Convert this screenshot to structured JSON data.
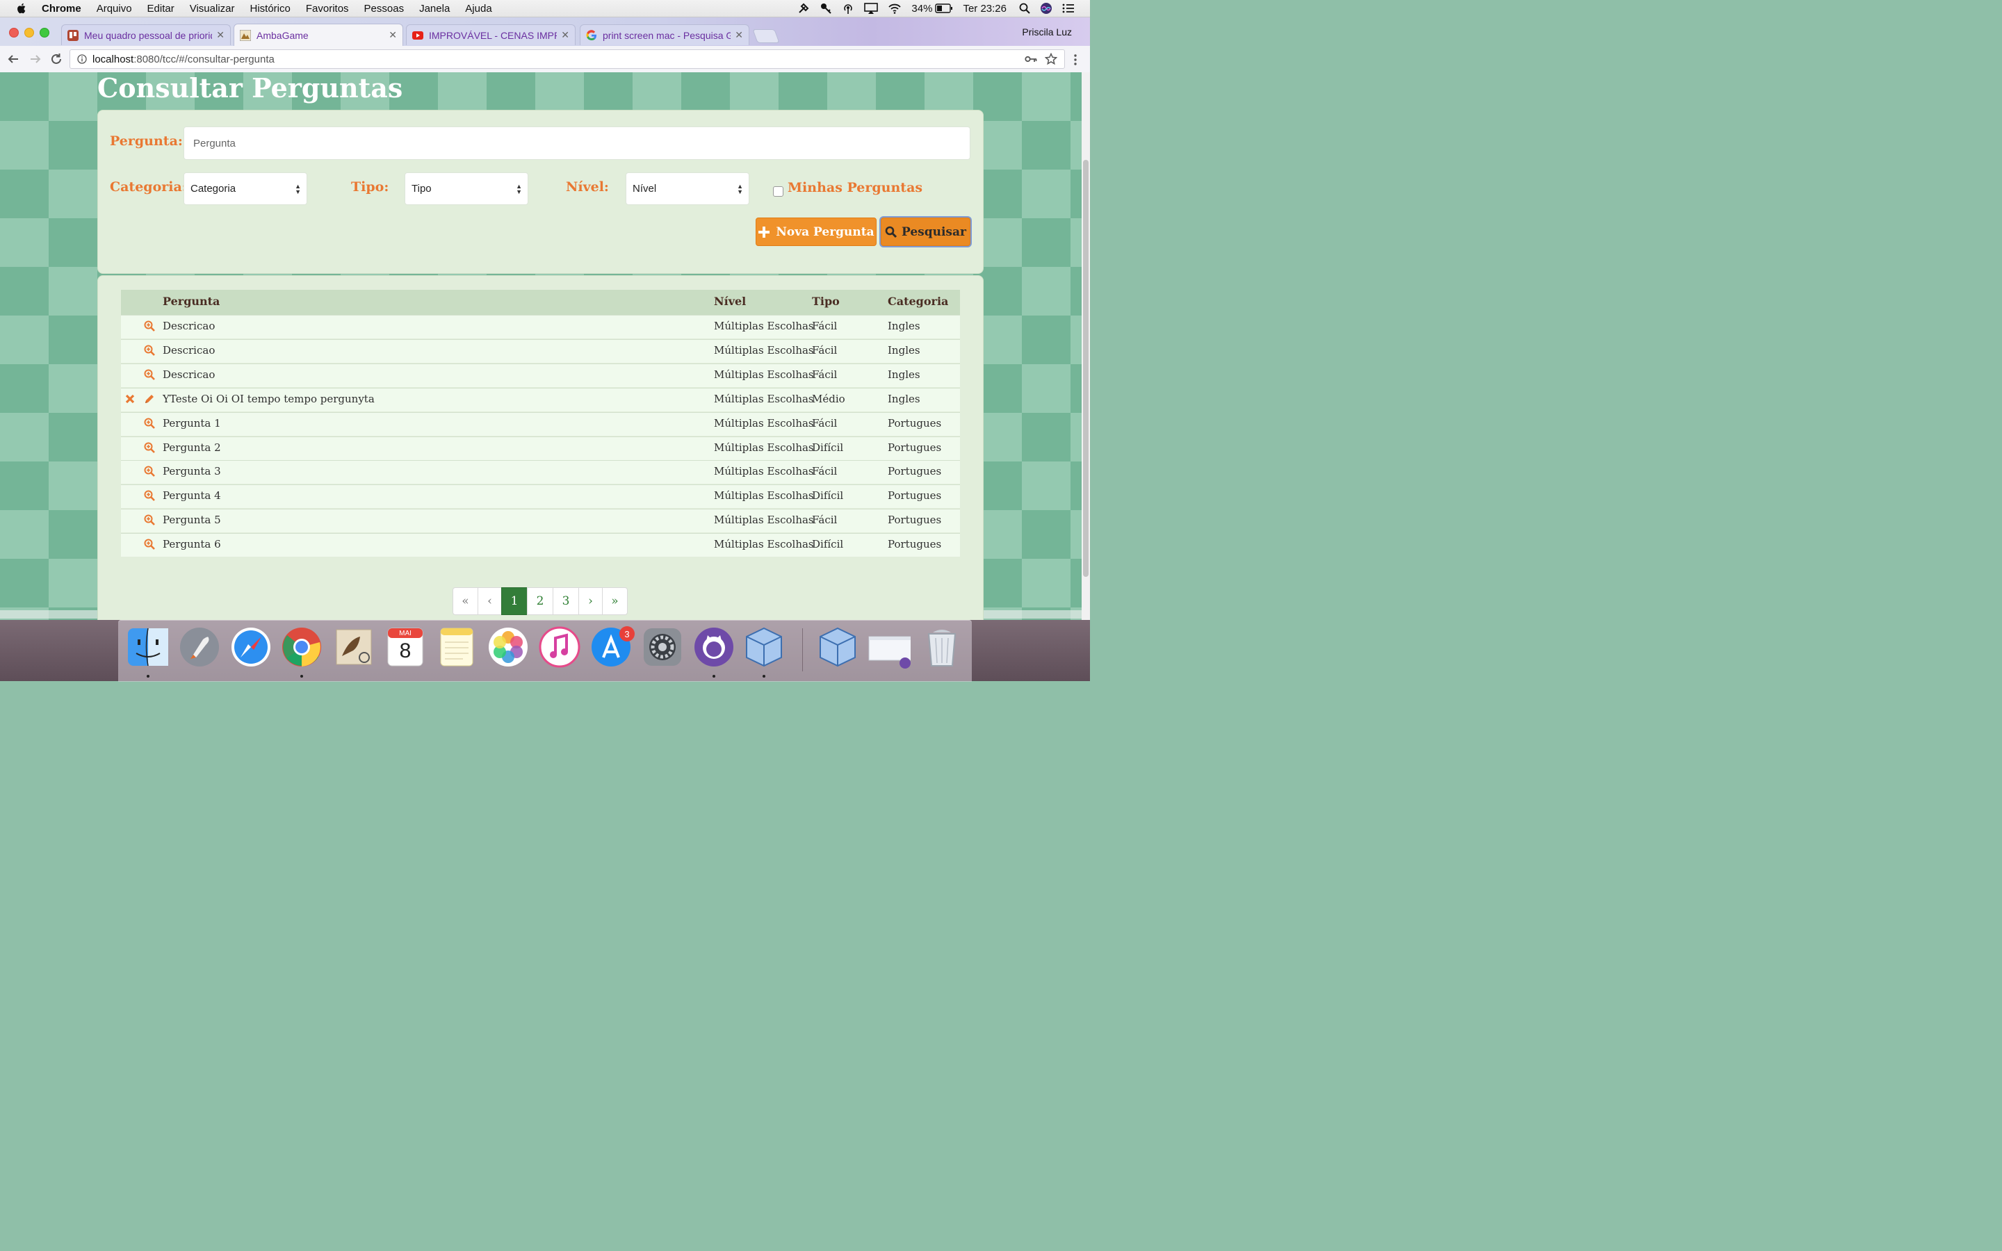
{
  "menubar": {
    "app": "Chrome",
    "items": [
      "Arquivo",
      "Editar",
      "Visualizar",
      "Histórico",
      "Favoritos",
      "Pessoas",
      "Janela",
      "Ajuda"
    ],
    "battery": "34%",
    "clock": "Ter 23:26"
  },
  "browser": {
    "tabs": [
      {
        "title": "Meu quadro pessoal de priorid",
        "favicon": "trello-icon"
      },
      {
        "title": "AmbaGame",
        "favicon": "ambagame-icon"
      },
      {
        "title": "IMPROVÁVEL - CENAS IMPROV",
        "favicon": "youtube-icon"
      },
      {
        "title": "print screen mac - Pesquisa G",
        "favicon": "google-icon"
      }
    ],
    "profile": "Priscila Luz",
    "url_host": "localhost",
    "url_path": ":8080/tcc/#/consultar-pergunta"
  },
  "page": {
    "title": "Consultar Perguntas",
    "filters": {
      "pergunta_label": "Pergunta:",
      "pergunta_placeholder": "Pergunta",
      "categoria_label": "Categoria:",
      "categoria_value": "Categoria",
      "tipo_label": "Tipo:",
      "tipo_value": "Tipo",
      "nivel_label": "Nível:",
      "nivel_value": "Nível",
      "minhas_label": "Minhas Perguntas",
      "minhas_checked": false
    },
    "buttons": {
      "nova": "Nova Pergunta",
      "pesquisar": "Pesquisar"
    },
    "table": {
      "headers": [
        "Pergunta",
        "Nível",
        "Tipo",
        "Categoria"
      ],
      "rows": [
        {
          "pergunta": "Descricao",
          "nivel": "Múltiplas Escolhas",
          "tipo": "Fácil",
          "categoria": "Ingles",
          "actions": [
            "view"
          ]
        },
        {
          "pergunta": "Descricao",
          "nivel": "Múltiplas Escolhas",
          "tipo": "Fácil",
          "categoria": "Ingles",
          "actions": [
            "view"
          ]
        },
        {
          "pergunta": "Descricao",
          "nivel": "Múltiplas Escolhas",
          "tipo": "Fácil",
          "categoria": "Ingles",
          "actions": [
            "view"
          ]
        },
        {
          "pergunta": "YTeste Oi Oi OI tempo tempo pergunyta",
          "nivel": "Múltiplas Escolhas",
          "tipo": "Médio",
          "categoria": "Ingles",
          "actions": [
            "delete",
            "edit"
          ]
        },
        {
          "pergunta": "Pergunta 1",
          "nivel": "Múltiplas Escolhas",
          "tipo": "Fácil",
          "categoria": "Portugues",
          "actions": [
            "view"
          ]
        },
        {
          "pergunta": "Pergunta 2",
          "nivel": "Múltiplas Escolhas",
          "tipo": "Difícil",
          "categoria": "Portugues",
          "actions": [
            "view"
          ]
        },
        {
          "pergunta": "Pergunta 3",
          "nivel": "Múltiplas Escolhas",
          "tipo": "Fácil",
          "categoria": "Portugues",
          "actions": [
            "view"
          ]
        },
        {
          "pergunta": "Pergunta 4",
          "nivel": "Múltiplas Escolhas",
          "tipo": "Difícil",
          "categoria": "Portugues",
          "actions": [
            "view"
          ]
        },
        {
          "pergunta": "Pergunta 5",
          "nivel": "Múltiplas Escolhas",
          "tipo": "Fácil",
          "categoria": "Portugues",
          "actions": [
            "view"
          ]
        },
        {
          "pergunta": "Pergunta 6",
          "nivel": "Múltiplas Escolhas",
          "tipo": "Difícil",
          "categoria": "Portugues",
          "actions": [
            "view"
          ]
        }
      ]
    },
    "pagination": {
      "first": "«",
      "prev": "‹",
      "pages": [
        "1",
        "2",
        "3"
      ],
      "current": "1",
      "next": "›",
      "last": "»"
    }
  },
  "dock": {
    "calendar_month": "MAI",
    "calendar_day": "8",
    "appstore_badge": "3"
  },
  "colors": {
    "accent_orange": "#f0922b",
    "label_orange": "#e97832",
    "page_green": "#74b597",
    "active_page": "#337d39"
  }
}
